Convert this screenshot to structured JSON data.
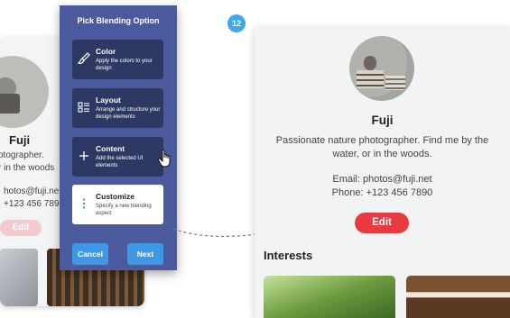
{
  "step_badge": "12",
  "background_profile": {
    "name": "Fuji",
    "bio_line1": "otographer.",
    "bio_line2": "r in the woods",
    "email": "hotos@fuji.ne",
    "phone": "+123 456 789",
    "edit_label": "Edit"
  },
  "panel": {
    "title": "Pick Blending Option",
    "options": [
      {
        "title": "Color",
        "description": "Apply the colors to your design",
        "icon": "paintbrush-icon"
      },
      {
        "title": "Layout",
        "description": "Arrange and structure your design elements",
        "icon": "layout-list-icon"
      },
      {
        "title": "Content",
        "description": "Add the selected UI elements",
        "icon": "plus-icon"
      },
      {
        "title": "Customize",
        "description": "Specify a new blending aspect",
        "icon": "vertical-dots-icon"
      }
    ],
    "cancel_label": "Cancel",
    "next_label": "Next"
  },
  "profile": {
    "name": "Fuji",
    "bio": "Passionate nature photographer. Find me by the water, or in the woods.",
    "email": "Email: photos@fuji.net",
    "phone": "Phone: +123 456 7890",
    "edit_label": "Edit",
    "interests_heading": "Interests"
  },
  "colors": {
    "panel_bg": "#4b5a9c",
    "option_bg": "#2d3962",
    "button_blue": "#3f98e5",
    "edit_red": "#e83a3f",
    "badge_blue": "#3fa9f0"
  }
}
